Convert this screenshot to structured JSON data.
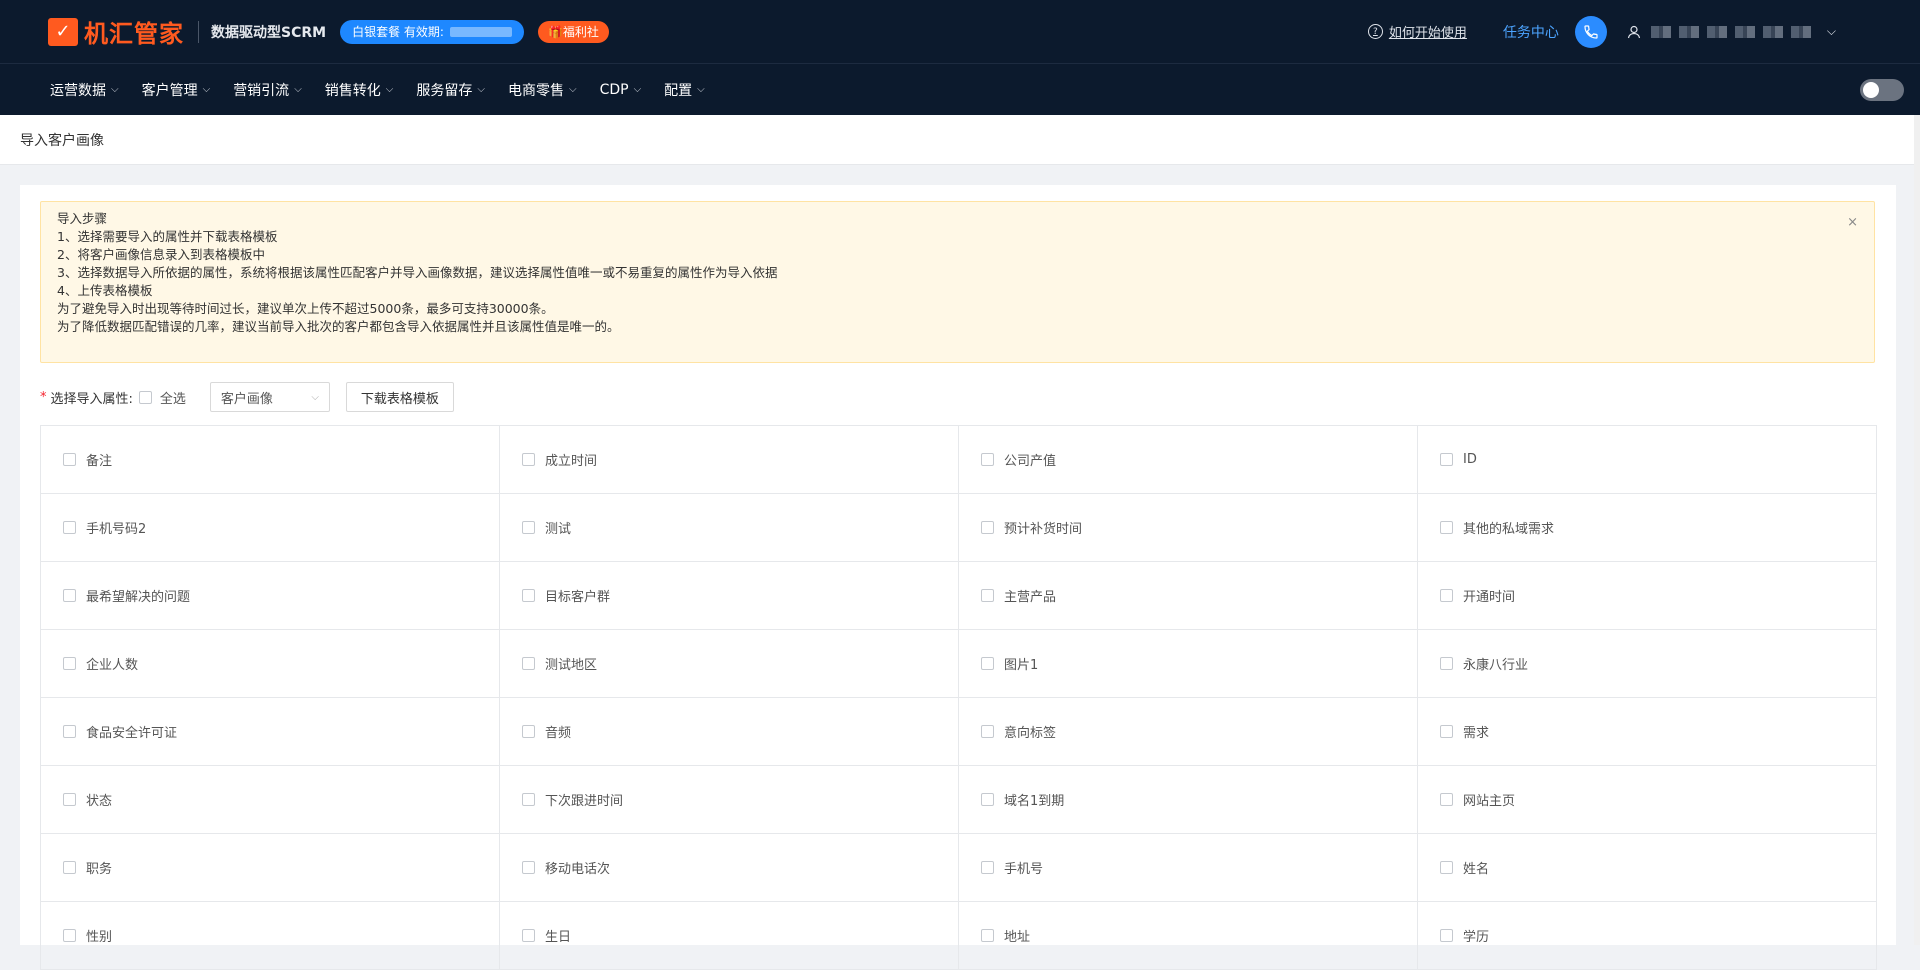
{
  "header": {
    "logo_mark": "✓",
    "logo_text": "机汇管家",
    "subtitle": "数据驱动型SCRM",
    "plan_label": "白银套餐 有效期:",
    "welfare_label": "🎁福利社",
    "help_label": "如何开始使用",
    "task_center_label": "任务中心"
  },
  "nav": {
    "items": [
      {
        "label": "运营数据"
      },
      {
        "label": "客户管理"
      },
      {
        "label": "营销引流"
      },
      {
        "label": "销售转化"
      },
      {
        "label": "服务留存"
      },
      {
        "label": "电商零售"
      },
      {
        "label": "CDP"
      },
      {
        "label": "配置"
      }
    ],
    "caret": "⌵"
  },
  "breadcrumb": {
    "title": "导入客户画像"
  },
  "alert": {
    "lines": [
      "导入步骤",
      "1、选择需要导入的属性并下载表格模板",
      "2、将客户画像信息录入到表格模板中",
      "3、选择数据导入所依据的属性，系统将根据该属性匹配客户并导入画像数据，建议选择属性值唯一或不易重复的属性作为导入依据",
      "4、上传表格模板",
      "为了避免导入时出现等待时间过长，建议单次上传不超过5000条，最多可支持30000条。",
      "为了降低数据匹配错误的几率，建议当前导入批次的客户都包含导入依据属性并且该属性值是唯一的。"
    ],
    "close_glyph": "×"
  },
  "controls": {
    "required_mark": "*",
    "attr_label": "选择导入属性:",
    "select_all_label": "全选",
    "select_value": "客户画像",
    "download_button": "下载表格模板"
  },
  "attributes": [
    "备注",
    "成立时间",
    "公司产值",
    "ID",
    "手机号码2",
    "测试",
    "预计补货时间",
    "其他的私域需求",
    "最希望解决的问题",
    "目标客户群",
    "主营产品",
    "开通时间",
    "企业人数",
    "测试地区",
    "图片1",
    "永康八行业",
    "食品安全许可证",
    "音频",
    "意向标签",
    "需求",
    "状态",
    "下次跟进时间",
    "域名1到期",
    "网站主页",
    "职务",
    "移动电话次",
    "手机号",
    "姓名",
    "性别",
    "生日",
    "地址",
    "学历"
  ],
  "colors": {
    "header_bg": "#0c1a2d",
    "brand_orange": "#ff5a1f",
    "accent_blue": "#1e88ff",
    "alert_bg": "#fff8e6"
  }
}
